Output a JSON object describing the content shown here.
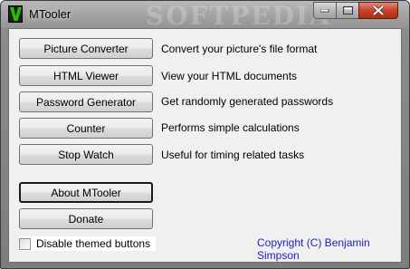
{
  "window": {
    "title": "MTooler",
    "watermark": "SOFTPEDIA"
  },
  "tools": [
    {
      "label": "Picture Converter",
      "description": "Convert your picture's file format"
    },
    {
      "label": "HTML Viewer",
      "description": "View your HTML documents"
    },
    {
      "label": "Password Generator",
      "description": "Get randomly generated passwords"
    },
    {
      "label": "Counter",
      "description": "Performs simple calculations"
    },
    {
      "label": "Stop Watch",
      "description": "Useful for timing related tasks"
    }
  ],
  "actions": {
    "about_label": "About MTooler",
    "donate_label": "Donate"
  },
  "options": {
    "disable_themed_label": "Disable themed buttons",
    "disable_themed_checked": false
  },
  "footer": {
    "copyright": "Copyright (C) Benjamin Simpson"
  },
  "colors": {
    "link": "#1f1fbf",
    "client_bg": "#f0f0f0",
    "close_button": "#c8412a",
    "icon_green": "#22c000"
  }
}
